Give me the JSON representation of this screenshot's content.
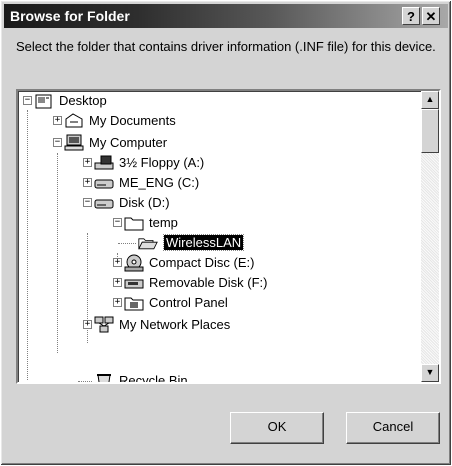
{
  "window": {
    "title": "Browse for Folder",
    "help_label": "?",
    "close_label": "✕"
  },
  "instructions": "Select the folder that contains driver information (.INF file) for this device.",
  "tree": [
    {
      "label": "Desktop",
      "icon": "desktop-icon",
      "expander": "−",
      "selected": false
    },
    {
      "label": "My Documents",
      "icon": "documents-folder-icon",
      "expander": "+",
      "selected": false
    },
    {
      "label": "My Computer",
      "icon": "computer-icon",
      "expander": "−",
      "selected": false
    },
    {
      "label": "3½ Floppy (A:)",
      "icon": "floppy-drive-icon",
      "expander": "+",
      "selected": false
    },
    {
      "label": "ME_ENG (C:)",
      "icon": "hard-drive-icon",
      "expander": "+",
      "selected": false
    },
    {
      "label": "Disk (D:)",
      "icon": "hard-drive-icon",
      "expander": "−",
      "selected": false
    },
    {
      "label": "temp",
      "icon": "folder-icon",
      "expander": "−",
      "selected": false
    },
    {
      "label": "WirelessLAN",
      "icon": "open-folder-icon",
      "expander": "",
      "selected": true
    },
    {
      "label": "Compact Disc (E:)",
      "icon": "cd-drive-icon",
      "expander": "+",
      "selected": false
    },
    {
      "label": "Removable Disk (F:)",
      "icon": "removable-disk-icon",
      "expander": "+",
      "selected": false
    },
    {
      "label": "Control Panel",
      "icon": "control-panel-icon",
      "expander": "+",
      "selected": false
    },
    {
      "label": "My Network Places",
      "icon": "network-places-icon",
      "expander": "+",
      "selected": false
    },
    {
      "label": "Recycle Bin",
      "icon": "recycle-bin-icon",
      "expander": "",
      "selected": false
    }
  ],
  "buttons": {
    "ok": "OK",
    "cancel": "Cancel"
  },
  "scrollbar": {
    "up_arrow": "▲",
    "down_arrow": "▼"
  }
}
